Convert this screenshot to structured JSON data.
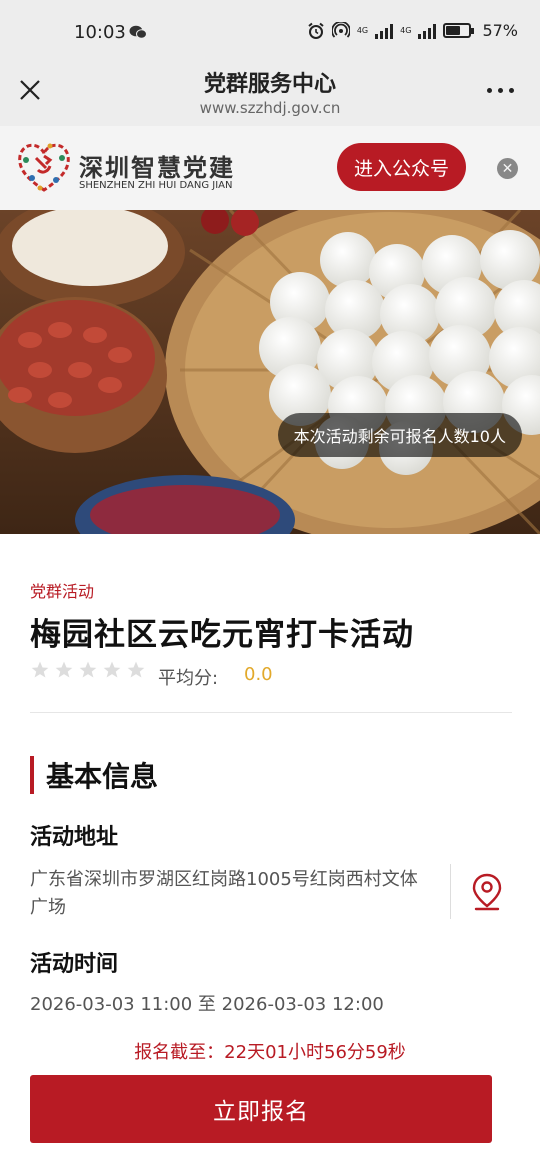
{
  "status_bar": {
    "time": "10:03",
    "network_1": "4G",
    "network_2": "4G",
    "battery": "57%"
  },
  "nav": {
    "title": "党群服务中心",
    "url": "www.szzhdj.gov.cn"
  },
  "brand": {
    "name": "深圳智慧党建",
    "subtitle": "SHENZHEN ZHI HUI DANG JIAN",
    "follow_label": "进入公众号"
  },
  "hero": {
    "remaining_badge": "本次活动剩余可报名人数10人"
  },
  "activity": {
    "category": "党群活动",
    "title": "梅园社区云吃元宵打卡活动",
    "rating_stars": 0,
    "score_label": "平均分:",
    "score_value": "0.0"
  },
  "basic_info": {
    "section_title": "基本信息",
    "address_label": "活动地址",
    "address": "广东省深圳市罗湖区红岗路1005号红岗西村文体广场",
    "time_label": "活动时间",
    "time": "2026-03-03 11:00 至 2026-03-03 12:00"
  },
  "deadline": "报名截至：22天01小时56分59秒",
  "signup_label": "立即报名",
  "colors": {
    "accent": "#b81b24",
    "score": "#e2a92b"
  }
}
